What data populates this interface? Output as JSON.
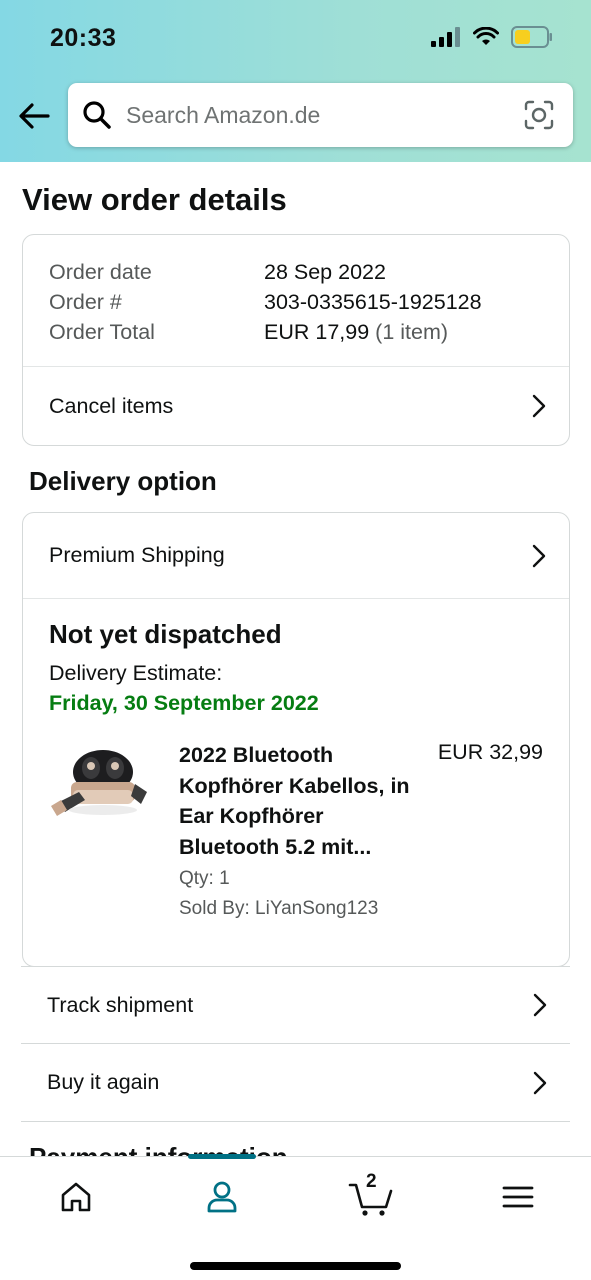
{
  "status_bar": {
    "time": "20:33"
  },
  "header": {
    "search_placeholder": "Search Amazon.de"
  },
  "page": {
    "title": "View order details"
  },
  "order_summary": {
    "rows": [
      {
        "label": "Order date",
        "value": "28 Sep 2022"
      },
      {
        "label": "Order #",
        "value": "303-0335615-1925128"
      },
      {
        "label": "Order Total",
        "value": "EUR 17,99",
        "extra": "(1 item)"
      }
    ],
    "cancel_label": "Cancel items"
  },
  "delivery": {
    "section_title": "Delivery option",
    "shipping_label": "Premium Shipping",
    "status": "Not yet dispatched",
    "estimate_label": "Delivery Estimate:",
    "estimate_date": "Friday, 30 September 2022",
    "accent_color": "#067d12",
    "item": {
      "name": "2022 Bluetooth Kopfhörer Kabellos, in Ear Kopfhörer Bluetooth 5.2 mit...",
      "price": "EUR 32,99",
      "qty": "Qty: 1",
      "seller": "Sold By: LiYanSong123"
    }
  },
  "actions": {
    "track_label": "Track shipment",
    "buy_again_label": "Buy it again"
  },
  "payment": {
    "section_title": "Payment information"
  },
  "bottom_nav": {
    "items": [
      {
        "icon": "home-icon"
      },
      {
        "icon": "user-icon",
        "active": true
      },
      {
        "icon": "cart-icon",
        "badge": "2"
      },
      {
        "icon": "menu-icon"
      }
    ],
    "active_color": "#007185"
  }
}
